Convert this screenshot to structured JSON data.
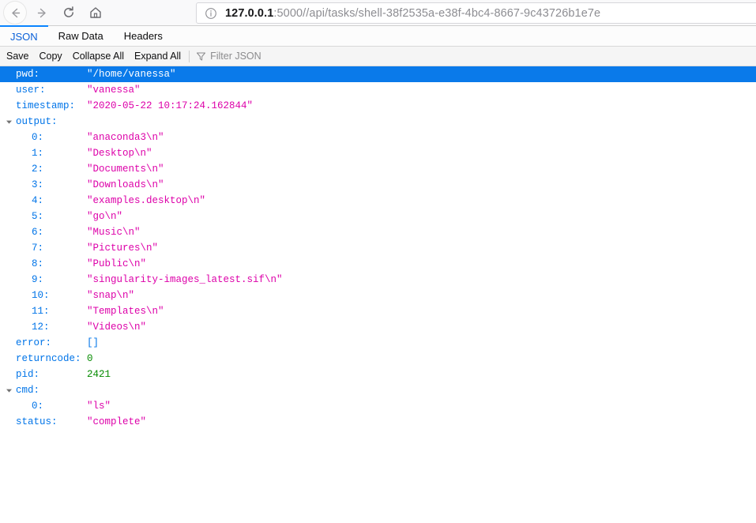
{
  "browser": {
    "nav": {
      "back_label": "Back",
      "forward_label": "Forward",
      "reload_label": "Reload",
      "home_label": "Home"
    },
    "urlbar": {
      "host": "127.0.0.1",
      "path": ":5000//api/tasks/shell-38f2535a-e38f-4bc4-8667-9c43726b1e7e",
      "full_url": "127.0.0.1:5000//api/tasks/shell-38f2535a-e38f-4bc4-8667-9c43726b1e7e",
      "identity_icon": "info-circle-icon"
    }
  },
  "viewer": {
    "tabs": [
      {
        "label": "JSON",
        "active": true
      },
      {
        "label": "Raw Data",
        "active": false
      },
      {
        "label": "Headers",
        "active": false
      }
    ],
    "toolbar": {
      "save_label": "Save",
      "copy_label": "Copy",
      "collapse_all_label": "Collapse All",
      "expand_all_label": "Expand All",
      "filter_placeholder": "Filter JSON",
      "filter_value": "",
      "filter_icon": "funnel-icon"
    },
    "colors": {
      "key": "#0074e8",
      "string": "#dd00a9",
      "number": "#058b00",
      "selection": "#0a7aea",
      "tab_active": "#0a84ff"
    }
  },
  "json_rows": [
    {
      "indent": 0,
      "expander": "none",
      "key": "pwd:",
      "value": "\"/home/vanessa\"",
      "type": "string",
      "selected": true
    },
    {
      "indent": 0,
      "expander": "none",
      "key": "user:",
      "value": "\"vanessa\"",
      "type": "string",
      "selected": false
    },
    {
      "indent": 0,
      "expander": "none",
      "key": "timestamp:",
      "value": "\"2020-05-22 10:17:24.162844\"",
      "type": "string",
      "selected": false
    },
    {
      "indent": 0,
      "expander": "expanded",
      "key": "output:",
      "value": "",
      "type": "none",
      "selected": false
    },
    {
      "indent": 1,
      "expander": "none",
      "key": "0:",
      "value": "\"anaconda3\\n\"",
      "type": "string",
      "selected": false
    },
    {
      "indent": 1,
      "expander": "none",
      "key": "1:",
      "value": "\"Desktop\\n\"",
      "type": "string",
      "selected": false
    },
    {
      "indent": 1,
      "expander": "none",
      "key": "2:",
      "value": "\"Documents\\n\"",
      "type": "string",
      "selected": false
    },
    {
      "indent": 1,
      "expander": "none",
      "key": "3:",
      "value": "\"Downloads\\n\"",
      "type": "string",
      "selected": false
    },
    {
      "indent": 1,
      "expander": "none",
      "key": "4:",
      "value": "\"examples.desktop\\n\"",
      "type": "string",
      "selected": false
    },
    {
      "indent": 1,
      "expander": "none",
      "key": "5:",
      "value": "\"go\\n\"",
      "type": "string",
      "selected": false
    },
    {
      "indent": 1,
      "expander": "none",
      "key": "6:",
      "value": "\"Music\\n\"",
      "type": "string",
      "selected": false
    },
    {
      "indent": 1,
      "expander": "none",
      "key": "7:",
      "value": "\"Pictures\\n\"",
      "type": "string",
      "selected": false
    },
    {
      "indent": 1,
      "expander": "none",
      "key": "8:",
      "value": "\"Public\\n\"",
      "type": "string",
      "selected": false
    },
    {
      "indent": 1,
      "expander": "none",
      "key": "9:",
      "value": "\"singularity-images_latest.sif\\n\"",
      "type": "string",
      "selected": false
    },
    {
      "indent": 1,
      "expander": "none",
      "key": "10:",
      "value": "\"snap\\n\"",
      "type": "string",
      "selected": false
    },
    {
      "indent": 1,
      "expander": "none",
      "key": "11:",
      "value": "\"Templates\\n\"",
      "type": "string",
      "selected": false
    },
    {
      "indent": 1,
      "expander": "none",
      "key": "12:",
      "value": "\"Videos\\n\"",
      "type": "string",
      "selected": false
    },
    {
      "indent": 0,
      "expander": "none",
      "key": "error:",
      "value": "[]",
      "type": "other",
      "selected": false
    },
    {
      "indent": 0,
      "expander": "none",
      "key": "returncode:",
      "value": "0",
      "type": "number",
      "selected": false
    },
    {
      "indent": 0,
      "expander": "none",
      "key": "pid:",
      "value": "2421",
      "type": "number",
      "selected": false
    },
    {
      "indent": 0,
      "expander": "expanded",
      "key": "cmd:",
      "value": "",
      "type": "none",
      "selected": false
    },
    {
      "indent": 1,
      "expander": "none",
      "key": "0:",
      "value": "\"ls\"",
      "type": "string",
      "selected": false
    },
    {
      "indent": 0,
      "expander": "none",
      "key": "status:",
      "value": "\"complete\"",
      "type": "string",
      "selected": false
    }
  ]
}
